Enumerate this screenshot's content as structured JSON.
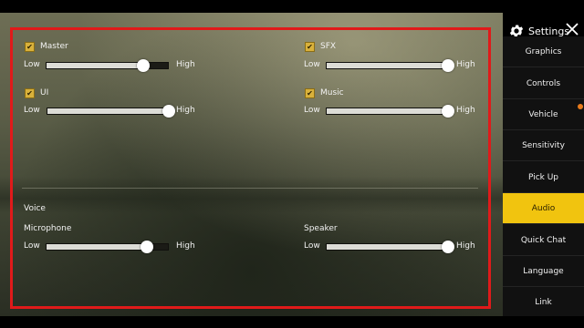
{
  "header": {
    "title": "Settings"
  },
  "sidebar": {
    "items": [
      {
        "label": "Graphics"
      },
      {
        "label": "Controls"
      },
      {
        "label": "Vehicle"
      },
      {
        "label": "Sensitivity"
      },
      {
        "label": "Pick Up"
      },
      {
        "label": "Audio",
        "active": true
      },
      {
        "label": "Quick Chat"
      },
      {
        "label": "Language"
      },
      {
        "label": "Link"
      }
    ]
  },
  "audio": {
    "low_label": "Low",
    "high_label": "High",
    "checkmark": "✔",
    "master": {
      "label": "Master",
      "checked": true,
      "value_fraction": 0.8
    },
    "sfx": {
      "label": "SFX",
      "checked": true,
      "value_fraction": 1.0
    },
    "ui": {
      "label": "UI",
      "checked": true,
      "value_fraction": 1.0
    },
    "music": {
      "label": "Music",
      "checked": true,
      "value_fraction": 1.0
    },
    "voice_heading": "Voice",
    "microphone": {
      "label": "Microphone",
      "value_fraction": 0.83
    },
    "speaker": {
      "label": "Speaker",
      "value_fraction": 1.0
    }
  },
  "colors": {
    "accent_active_tab": "#f1c40f",
    "checkbox": "#d9b13b",
    "highlight_frame": "#e01a1a"
  },
  "icons": {
    "settings": "gear-icon",
    "close": "close-icon"
  }
}
